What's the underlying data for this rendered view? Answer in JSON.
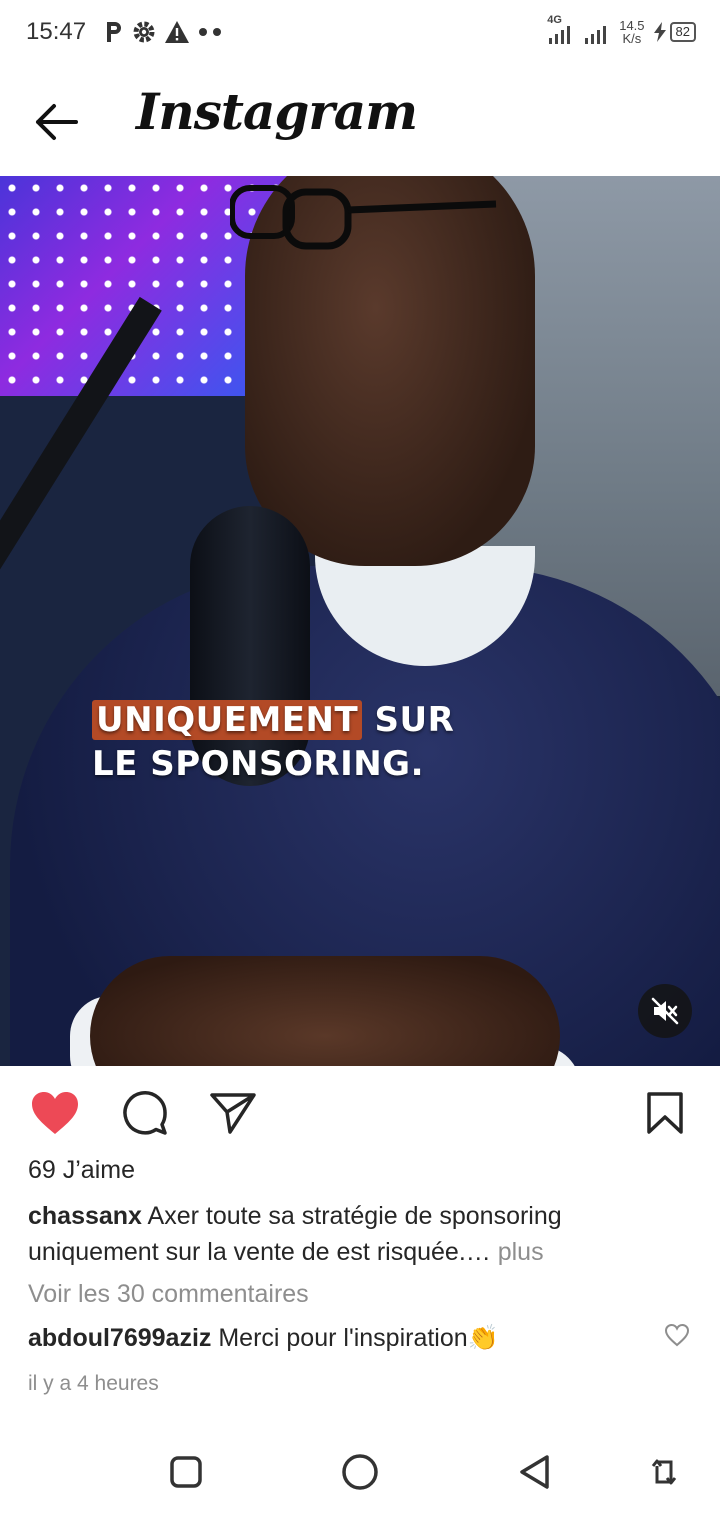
{
  "status_bar": {
    "time": "15:47",
    "network_type": "4G",
    "net_speed_value": "14.5",
    "net_speed_unit": "K/s",
    "battery": "82",
    "icons": [
      "parking-icon",
      "gear-icon",
      "warning-icon",
      "more-dots-icon"
    ]
  },
  "header": {
    "title": "Instagram",
    "back_icon": "arrow-left-icon"
  },
  "media": {
    "overlay_line1_highlight": "UNIQUEMENT",
    "overlay_line1_rest": " SUR",
    "overlay_line2": "LE SPONSORING.",
    "mute_icon": "volume-muted-icon"
  },
  "actions": {
    "liked": true,
    "like_color": "#ed4956",
    "icons": [
      "heart-filled-icon",
      "comment-icon",
      "send-icon",
      "bookmark-icon"
    ]
  },
  "post": {
    "likes": "69 J’aime",
    "username": "chassanx",
    "caption": " Axer toute sa stratégie de sponsoring uniquement sur la vente de est risquée.… ",
    "more_label": "plus",
    "view_comments": "Voir les 30 commentaires",
    "comment_user": "abdoul7699aziz",
    "comment_text": " Merci pour l'inspiration👏",
    "timestamp": "il y a 4 heures"
  },
  "nav_bar": {
    "icons": [
      "recents-square-icon",
      "home-circle-icon",
      "back-triangle-icon",
      "rotate-icon"
    ]
  }
}
